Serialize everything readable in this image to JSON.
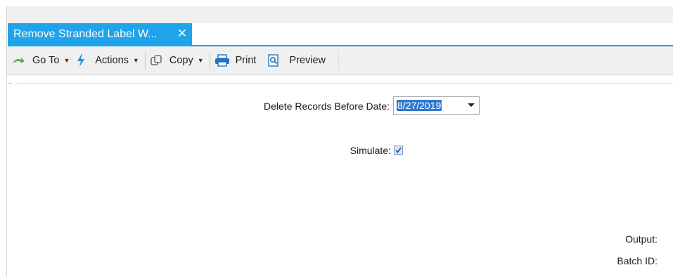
{
  "tab": {
    "title": "Remove Stranded Label W...",
    "close_glyph": "✕"
  },
  "toolbar": {
    "goto_label": "Go To",
    "actions_label": "Actions",
    "copy_label": "Copy",
    "print_label": "Print",
    "preview_label": "Preview"
  },
  "form": {
    "delete_before_label": "Delete Records Before Date:",
    "delete_before_value": "8/27/2019",
    "simulate_label": "Simulate:",
    "simulate_checked": "true",
    "output_label": "Output:",
    "batch_id_label": "Batch ID:"
  },
  "icons": {
    "goto": "green-arrow-icon",
    "actions": "lightning-icon",
    "copy": "copy-icon",
    "print": "printer-icon",
    "preview": "preview-icon"
  },
  "colors": {
    "accent": "#1fa3ea",
    "selection": "#3079d0",
    "toolbar_bg": "#f0f0f0"
  }
}
